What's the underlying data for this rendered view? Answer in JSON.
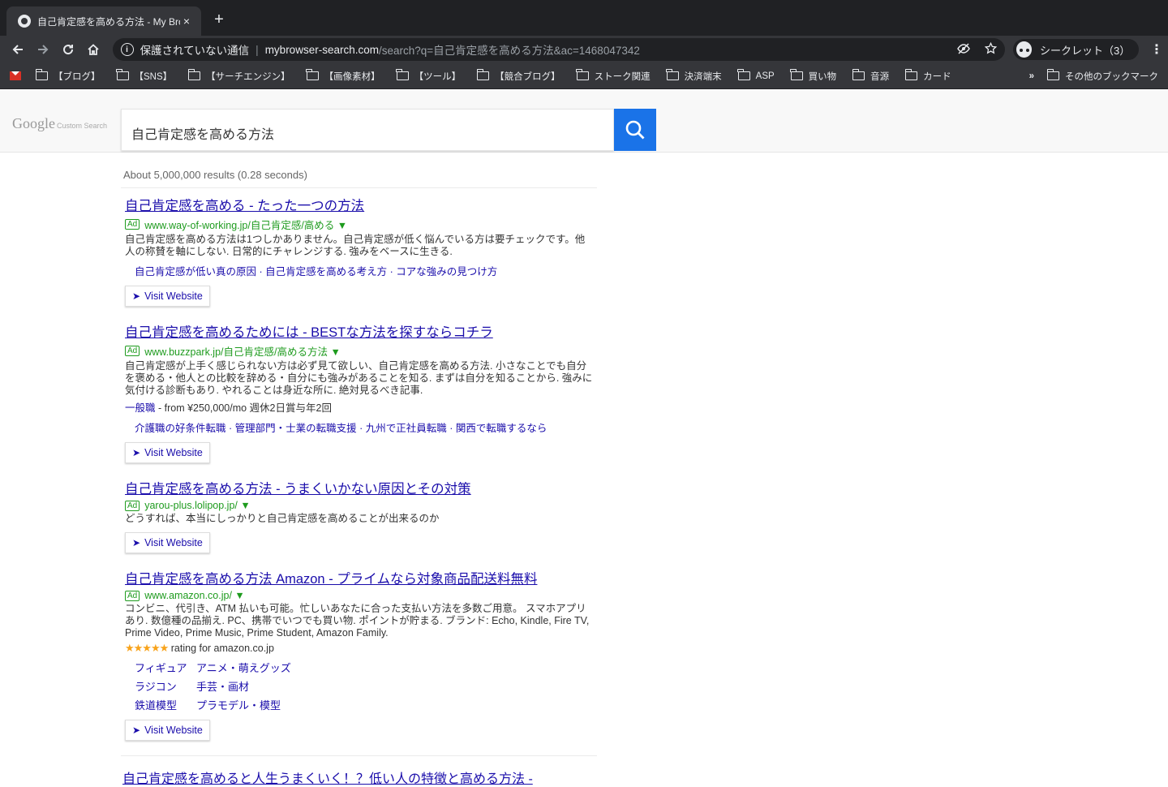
{
  "tab": {
    "title": "自己肯定感を高める方法 - My Brow",
    "close": "×",
    "new_tab": "+"
  },
  "toolbar": {
    "security": "保護されていない通信",
    "separator": "|",
    "host": "mybrowser-search.com",
    "path": "/search?q=自己肯定感を高める方法&ac=1468047342",
    "incognito": "シークレット（3）"
  },
  "bookmarks": {
    "items": [
      "【ブログ】",
      "【SNS】",
      "【サーチエンジン】",
      "【画像素材】",
      "【ツール】",
      "【競合ブログ】",
      "ストーク関連",
      "決済端末",
      "ASP",
      "買い物",
      "音源",
      "カード"
    ],
    "more": "»",
    "other": "その他のブックマーク"
  },
  "search": {
    "logo_text": "Google",
    "logo_sub": "Custom Search",
    "query": "自己肯定感を高める方法",
    "result_stats": "About 5,000,000 results (0.28 seconds)"
  },
  "colors": {
    "accent": "#1a73e8",
    "link": "#1a0dab",
    "url_green": "#1e9b1e",
    "chrome_dark": "#202124",
    "chrome_mid": "#35363a"
  },
  "ads": [
    {
      "title_a": "自己肯定感を高める - たった一つの方法",
      "badge": "Ad",
      "url": "www.way-of-working.jp/自己肯定感/高める ▼",
      "desc": "自己肯定感を高める方法は1つしかありません。自己肯定感が低く悩んでいる方は要チェックです。他人の称賛を軸にしない. 日常的にチャレンジする. 強みをベースに生きる.",
      "sitelinks": "自己肯定感が低い真の原因 · 自己肯定感を高める考え方 · コアな強みの見つけ方",
      "visit": "Visit Website"
    },
    {
      "title_a": "自己肯定感を高めるためには - BESTな方法を探すならコチラ",
      "badge": "Ad",
      "url": "www.buzzpark.jp/自己肯定感/高める方法 ▼",
      "desc": "自己肯定感が上手く感じられない方は必ず見て欲しい、自己肯定感を高める方法. 小さなことでも自分を褒める・他人との比較を辞める・自分にも強みがあることを知る. まずは自分を知ることから. 強みに気付ける診断もあり. やれることは身近な所に. 絶対見るべき記事.",
      "extra_link": "一般職",
      "extra_text": " - from ¥250,000/mo  週休2日賞与年2回",
      "sitelinks": "介護職の好条件転職 · 管理部門・士業の転職支援 · 九州で正社員転職 · 関西で転職するなら",
      "visit": "Visit Website"
    },
    {
      "title_a": "自己肯定感を高める方法 - うまくいかない原因とその対策",
      "badge": "Ad",
      "url": "yarou-plus.lolipop.jp/ ▼",
      "desc": "どうすれば、本当にしっかりと自己肯定感を高めることが出来るのか",
      "visit": "Visit Website"
    },
    {
      "title_a": "自己肯定感を高める方法 Amazon - プライムなら対象商品配送料無料",
      "badge": "Ad",
      "url": "www.amazon.co.jp/ ▼",
      "desc": "コンビニ、代引き、ATM 払いも可能。忙しいあなたに合った支払い方法を多数ご用意。 スマホアプリあり. 数億種の品揃え. PC、携帯でいつでも買い物. ポイントが貯まる. ブランド: Echo, Kindle, Fire TV, Prime Video, Prime Music, Prime Student, Amazon Family.",
      "rating_stars": "★★★★★",
      "rating_value": 5,
      "rating_text": " rating for amazon.co.jp",
      "links": [
        "フィギュア",
        "アニメ・萌えグッズ",
        "ラジコン",
        "手芸・画材",
        "鉄道模型",
        "プラモデル・模型"
      ],
      "visit": "Visit Website"
    }
  ],
  "next_result": "自己肯定感を高めると人生うまくいく！？低い人の特徴と高める方法 -"
}
